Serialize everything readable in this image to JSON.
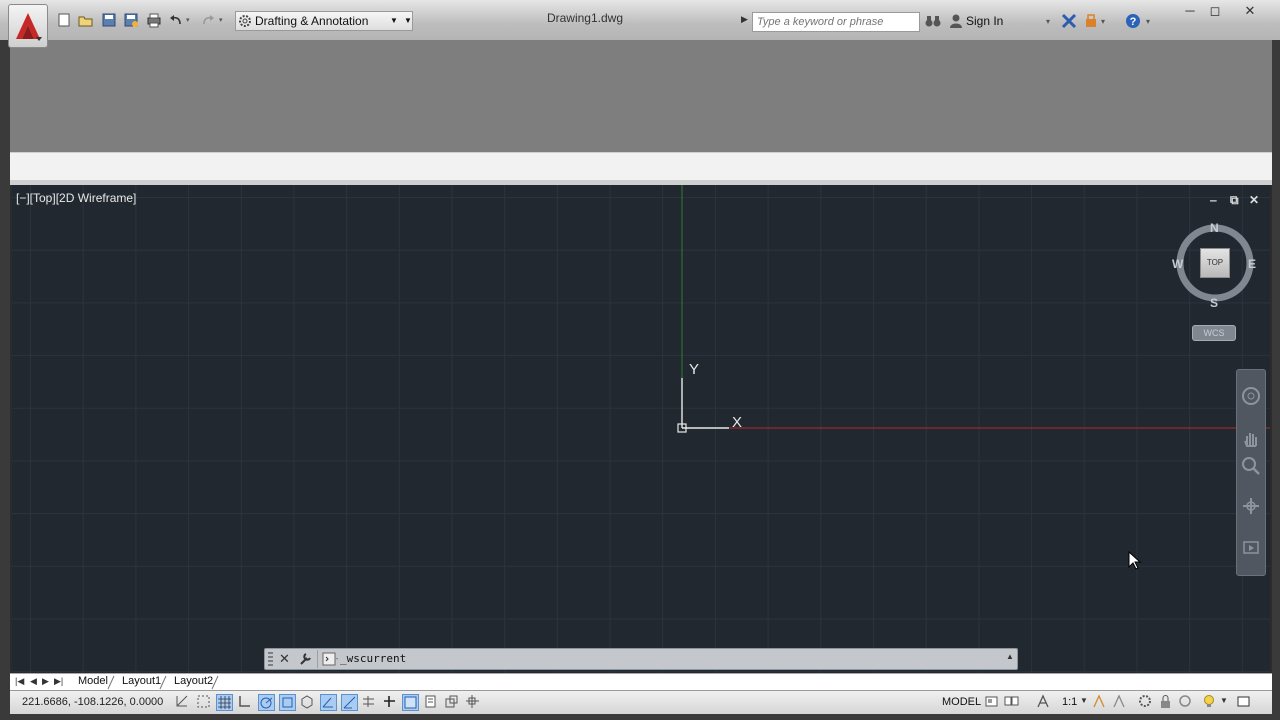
{
  "window": {
    "document_title": "Drawing1.dwg",
    "search_placeholder": "Type a keyword or phrase",
    "sign_in_label": "Sign In"
  },
  "workspace": {
    "selected": "Drafting & Annotation"
  },
  "quick_access": [
    "new-icon",
    "open-icon",
    "save-icon",
    "save-as-icon",
    "plot-icon",
    "undo-icon",
    "redo-icon"
  ],
  "viewport": {
    "label": "[−][Top][2D Wireframe]",
    "controls": {
      "minimize": "‒",
      "restore": "⧉",
      "close": "✕"
    },
    "ucs": {
      "x_label": "X",
      "y_label": "Y"
    },
    "viewcube": {
      "top_face": "TOP",
      "north": "N",
      "south": "S",
      "east": "E",
      "west": "W",
      "wcs_label": "WCS"
    }
  },
  "command_line": {
    "text": "_wscurrent"
  },
  "layout_tabs": [
    {
      "label": "Model",
      "active": true
    },
    {
      "label": "Layout1",
      "active": false
    },
    {
      "label": "Layout2",
      "active": false
    }
  ],
  "status_bar": {
    "coordinates": "221.6686,  -108.1226, 0.0000",
    "space_label": "MODEL",
    "annotation_scale": "1:1"
  },
  "colors": {
    "viewport_bg": "#212830",
    "grid_line": "#2b333d",
    "x_axis": "#b32a2a",
    "y_axis": "#2f7d2f",
    "ribbon": "#7e7e7e",
    "accent": "#c62828"
  }
}
